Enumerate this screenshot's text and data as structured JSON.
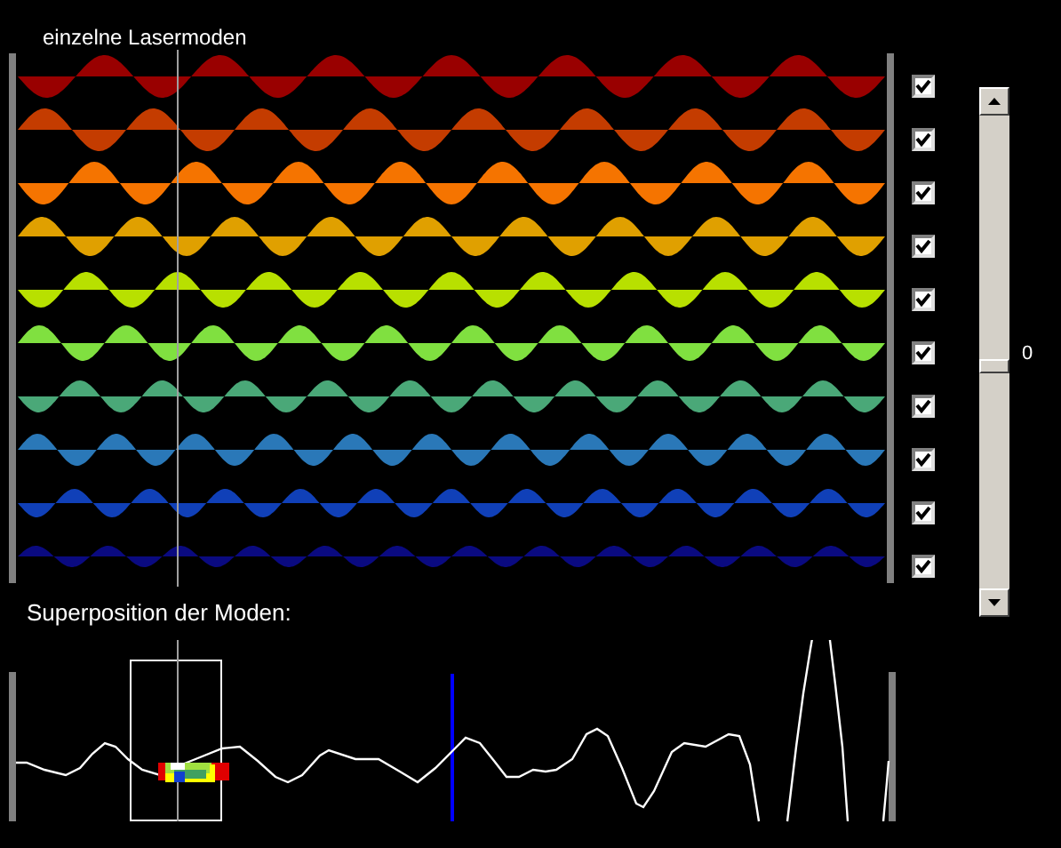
{
  "title": "einzelne Lasermoden",
  "modes": [
    {
      "checked": true,
      "color": "#990000"
    },
    {
      "checked": true,
      "color": "#c43c00"
    },
    {
      "checked": true,
      "color": "#f57400"
    },
    {
      "checked": true,
      "color": "#e0a000"
    },
    {
      "checked": true,
      "color": "#b8e000"
    },
    {
      "checked": true,
      "color": "#80e040"
    },
    {
      "checked": true,
      "color": "#4aa878"
    },
    {
      "checked": true,
      "color": "#2a78b8"
    },
    {
      "checked": true,
      "color": "#1040b8"
    },
    {
      "checked": true,
      "color": "#0a0a80"
    }
  ],
  "slider": {
    "reading": "0"
  },
  "superposition_label": "Superposition der Moden:"
}
